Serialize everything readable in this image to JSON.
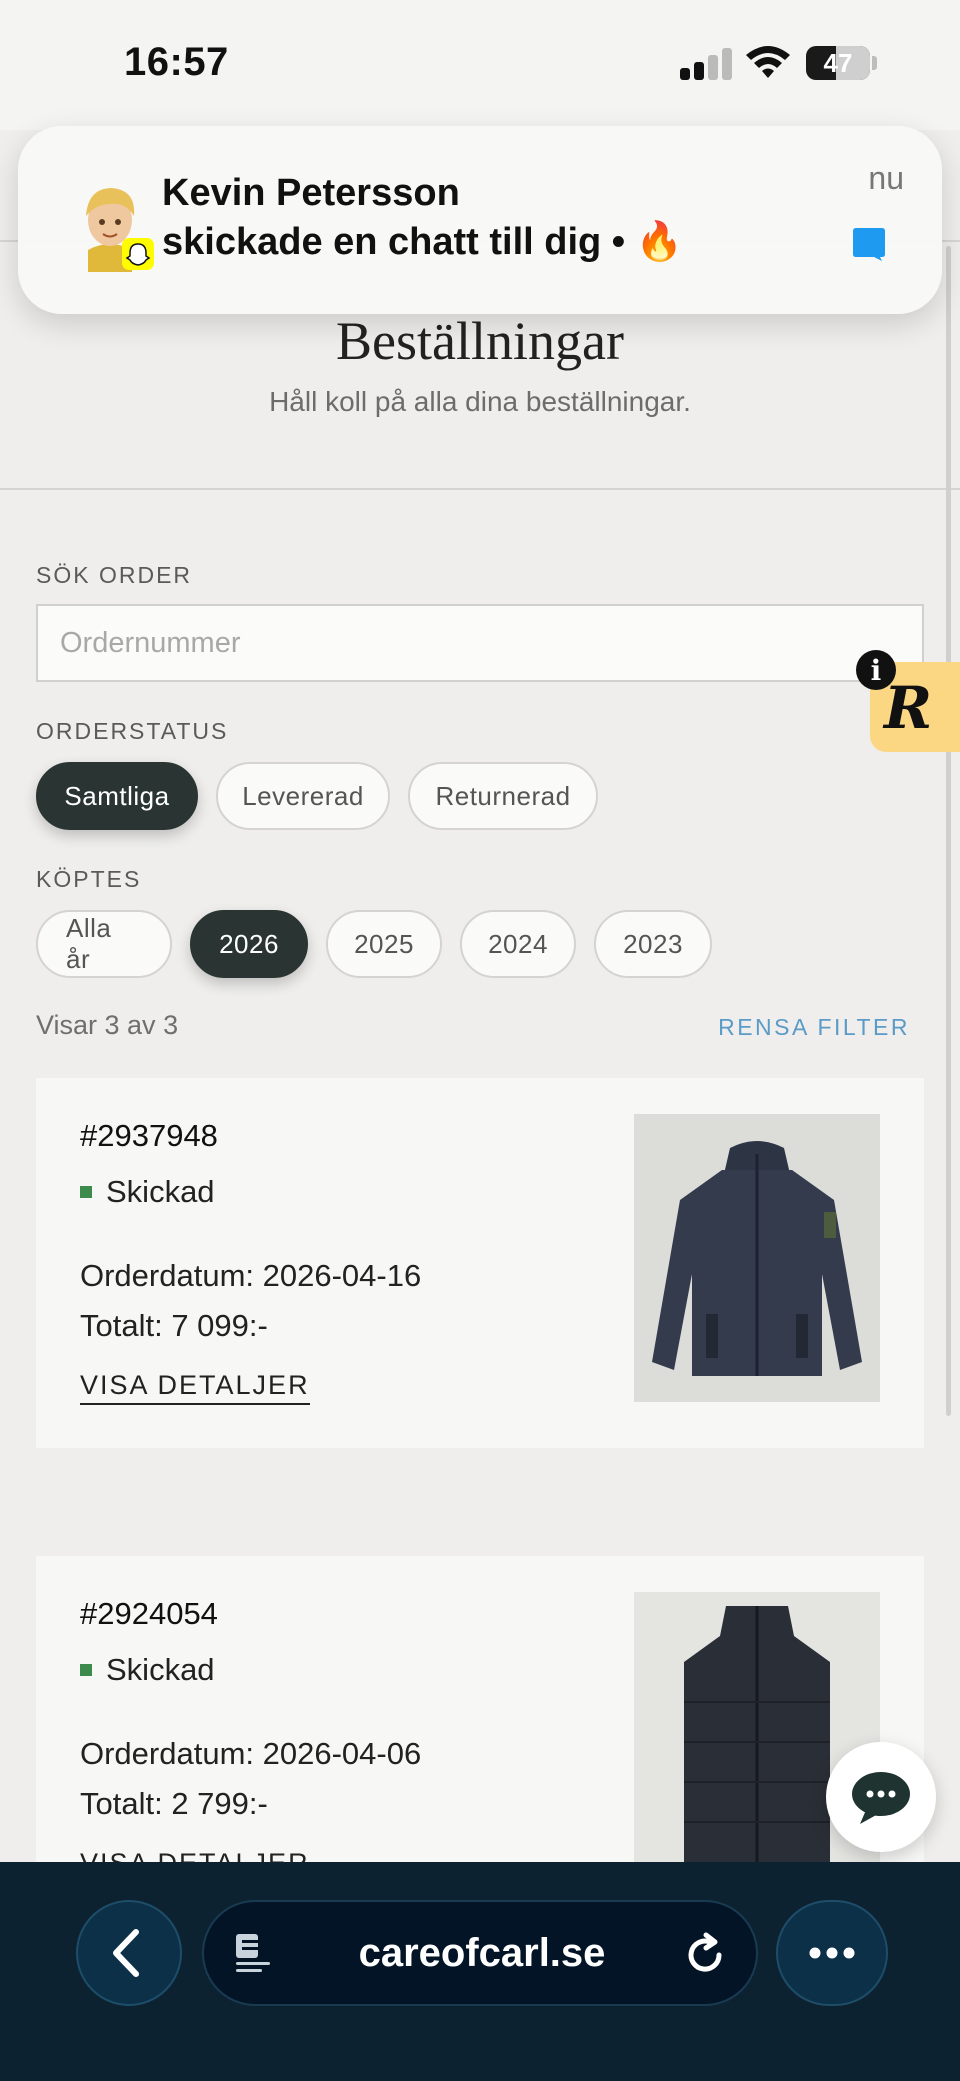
{
  "status_bar": {
    "time": "16:57",
    "battery": "47",
    "battery_level": 0.47
  },
  "notification": {
    "sender": "Kevin Petersson",
    "message": "skickade en chatt till dig • 🔥",
    "time": "nu",
    "app_icon": "snapchat-icon"
  },
  "page": {
    "title": "Beställningar",
    "subtitle": "Håll koll på alla dina beställningar."
  },
  "search": {
    "label": "SÖK ORDER",
    "placeholder": "Ordernummer",
    "value": ""
  },
  "status_filter": {
    "label": "ORDERSTATUS",
    "options": [
      "Samtliga",
      "Levererad",
      "Returnerad"
    ],
    "selected": "Samtliga"
  },
  "year_filter": {
    "label": "KÖPTES",
    "options": [
      "Alla år",
      "2026",
      "2025",
      "2024",
      "2023"
    ],
    "selected": "2026"
  },
  "results": {
    "count_text": "Visar 3 av 3",
    "clear_label": "RENSA FILTER"
  },
  "orders": [
    {
      "number": "#2937948",
      "status": "Skickad",
      "date": "Orderdatum: 2026-04-16",
      "total": "Totalt: 7 099:-",
      "details_label": "VISA DETALJER",
      "image": "jacket-image"
    },
    {
      "number": "#2924054",
      "status": "Skickad",
      "date": "Orderdatum: 2026-04-06",
      "total": "Totalt: 2 799:-",
      "details_label": "VISA DETALJER",
      "image": "vest-image"
    }
  ],
  "browser": {
    "url": "careofcarl.se"
  },
  "colors": {
    "accent_dark": "#2a3533",
    "link_blue": "#5a9bc7",
    "status_green": "#3c8a4c",
    "browser_bar": "#0d2230",
    "reviews_yellow": "#fbd783"
  }
}
